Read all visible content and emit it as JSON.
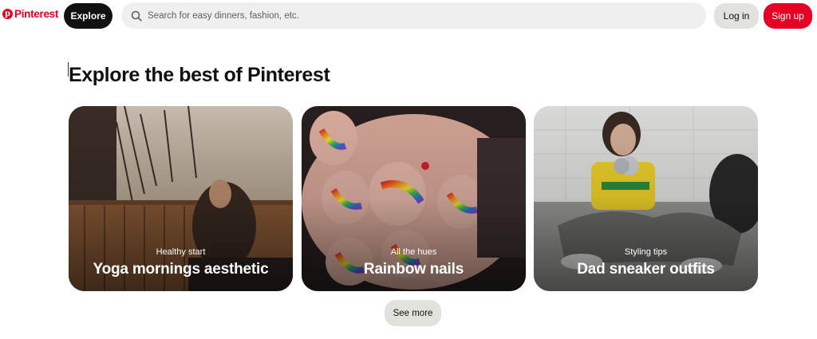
{
  "header": {
    "logo_text": "Pinterest",
    "explore_label": "Explore",
    "search": {
      "placeholder": "Search for easy dinners, fashion, etc.",
      "value": ""
    },
    "login_label": "Log in",
    "signup_label": "Sign up"
  },
  "colors": {
    "brand": "#e60023",
    "explore_bg": "#111111",
    "secondary_button": "#e2e2dc",
    "search_bg": "#efefef"
  },
  "icons": [
    "pinterest-logo-icon",
    "search-icon"
  ],
  "main": {
    "heading": "Explore the best of Pinterest",
    "cards": [
      {
        "subtitle": "Healthy start",
        "title": "Yoga mornings aesthetic"
      },
      {
        "subtitle": "All the hues",
        "title": "Rainbow nails"
      },
      {
        "subtitle": "Styling tips",
        "title": "Dad sneaker outfits"
      }
    ],
    "see_more_label": "See more"
  }
}
